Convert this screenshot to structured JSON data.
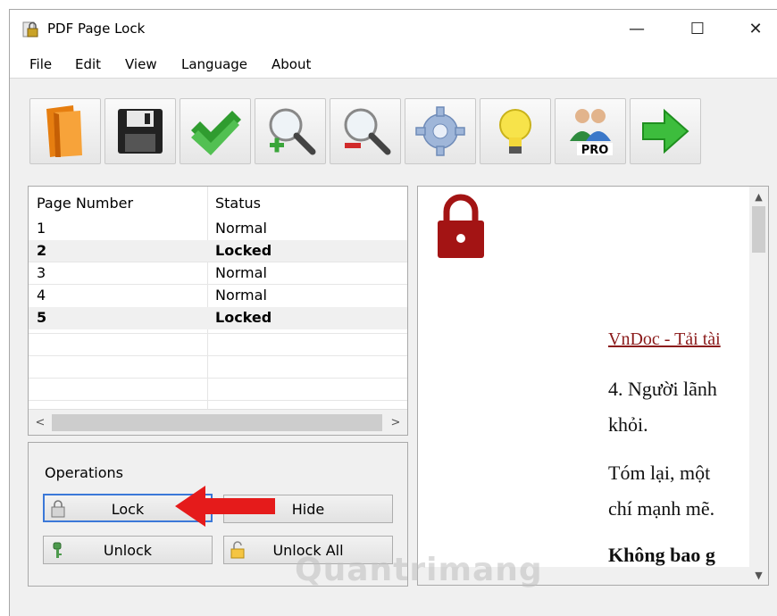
{
  "window": {
    "title": "PDF Page Lock",
    "minimize": "—",
    "maximize": "☐",
    "close": "✕"
  },
  "menu": [
    "File",
    "Edit",
    "View",
    "Language",
    "About"
  ],
  "toolbar": [
    {
      "name": "open-folder-icon"
    },
    {
      "name": "save-icon"
    },
    {
      "name": "apply-check-icon"
    },
    {
      "name": "zoom-in-icon"
    },
    {
      "name": "zoom-out-icon"
    },
    {
      "name": "settings-gear-icon"
    },
    {
      "name": "tip-lightbulb-icon"
    },
    {
      "name": "pro-users-icon",
      "badge": "PRO"
    },
    {
      "name": "next-arrow-icon"
    }
  ],
  "page_list": {
    "headers": [
      "Page Number",
      "Status"
    ],
    "rows": [
      {
        "page": "1",
        "status": "Normal",
        "locked": false
      },
      {
        "page": "2",
        "status": "Locked",
        "locked": true
      },
      {
        "page": "3",
        "status": "Normal",
        "locked": false
      },
      {
        "page": "4",
        "status": "Normal",
        "locked": false
      },
      {
        "page": "5",
        "status": "Locked",
        "locked": true
      }
    ],
    "scroll_left": "<",
    "scroll_right": ">"
  },
  "operations": {
    "title": "Operations",
    "lock": "Lock",
    "hide": "Hide",
    "unlock": "Unlock",
    "unlock_all": "Unlock All"
  },
  "preview": {
    "header_link": "VnDoc - Tải tài",
    "line1": "4. Người lãnh",
    "line2": "khỏi.",
    "line3": "Tóm lại, một",
    "line4": "chí mạnh mẽ.",
    "line5": "Không bao g"
  },
  "watermark": "Quantrimang",
  "colors": {
    "lock_red": "#a31414",
    "focus_blue": "#3b78d8",
    "arrow_red": "#e51b1b"
  }
}
